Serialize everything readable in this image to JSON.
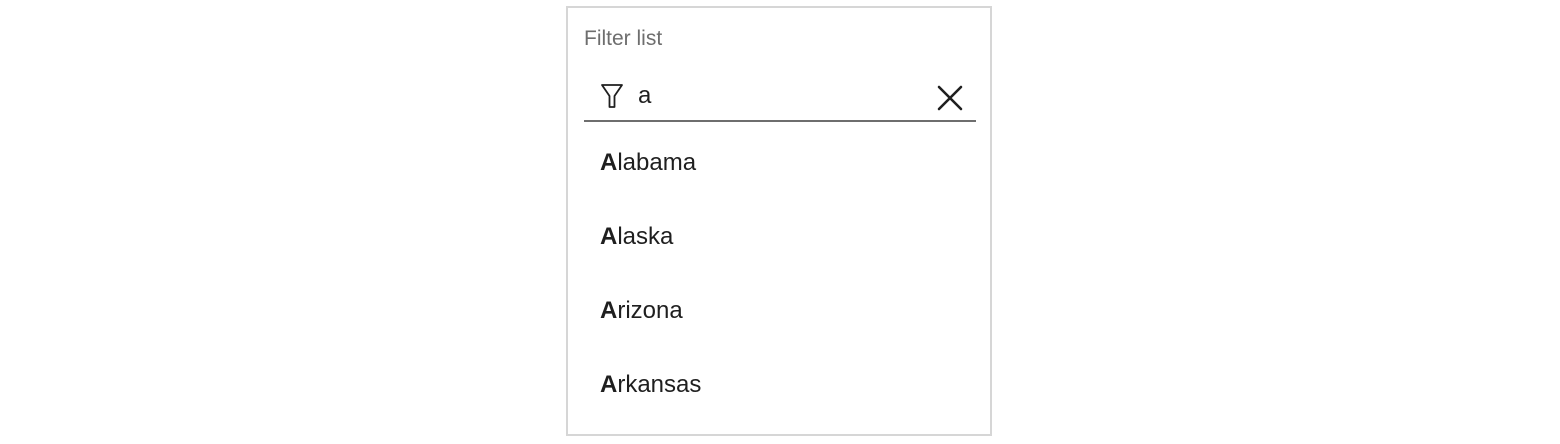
{
  "panel": {
    "title": "Filter list"
  },
  "filter": {
    "value": "a",
    "filter_icon": "filter-funnel-icon",
    "clear_icon": "close-x-icon"
  },
  "items": [
    {
      "match": "A",
      "rest": "labama"
    },
    {
      "match": "A",
      "rest": "laska"
    },
    {
      "match": "A",
      "rest": "rizona"
    },
    {
      "match": "A",
      "rest": "rkansas"
    }
  ]
}
